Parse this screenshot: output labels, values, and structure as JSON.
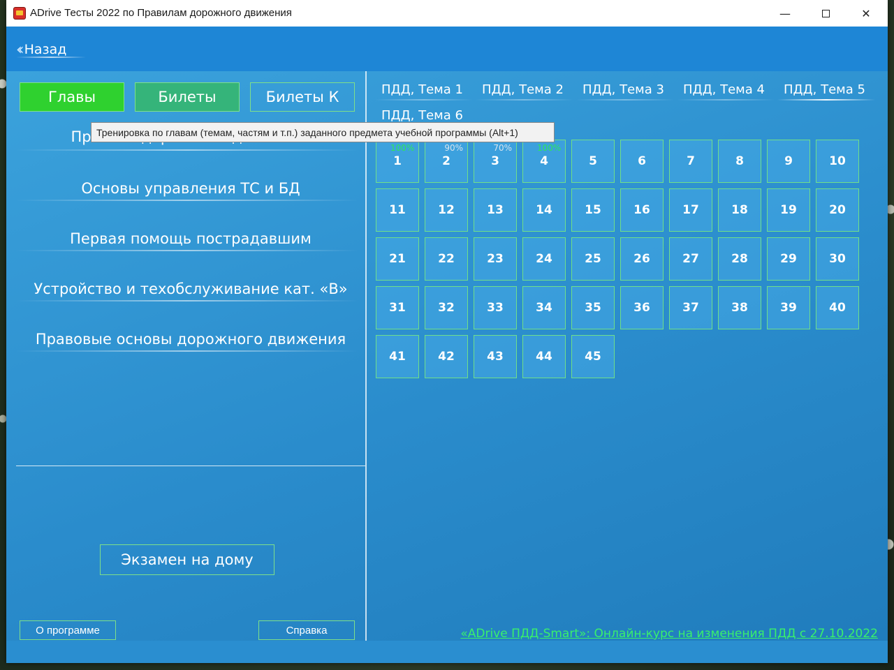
{
  "window": {
    "title": "ADrive Тесты 2022 по Правилам дорожного движения",
    "minimize": "—",
    "close": "✕"
  },
  "header": {
    "back_label": "Назад",
    "back_icon": "double-chevron-left-icon"
  },
  "tabs": [
    {
      "label": "Главы",
      "active": true
    },
    {
      "label": "Билеты",
      "active": false
    },
    {
      "label": "Билеты К",
      "active": false
    }
  ],
  "tooltip": "Тренировка по главам (темам, частям и т.п.) заданного предмета учебной программы (Alt+1)",
  "chapters": [
    "Правила дорожного движения",
    "Основы управления ТС и БД",
    "Первая помощь пострадавшим",
    "Устройство и техобслуживание кат. «В»",
    "Правовые основы дорожного движения"
  ],
  "exam_button": "Экзамен на дому",
  "about_button": "О программе",
  "help_button": "Справка",
  "topics": [
    {
      "label": "ПДД, Тема 1",
      "active": false
    },
    {
      "label": "ПДД, Тема 2",
      "active": false
    },
    {
      "label": "ПДД, Тема 3",
      "active": false
    },
    {
      "label": "ПДД, Тема 4",
      "active": false
    },
    {
      "label": "ПДД, Тема 5",
      "active": true
    },
    {
      "label": "ПДД, Тема 6",
      "active": false
    }
  ],
  "tiles": [
    {
      "n": "1",
      "pct": "100%"
    },
    {
      "n": "2",
      "pct": "90%"
    },
    {
      "n": "3",
      "pct": "70%"
    },
    {
      "n": "4",
      "pct": "100%"
    },
    {
      "n": "5",
      "pct": ""
    },
    {
      "n": "6",
      "pct": ""
    },
    {
      "n": "7",
      "pct": ""
    },
    {
      "n": "8",
      "pct": ""
    },
    {
      "n": "9",
      "pct": ""
    },
    {
      "n": "10",
      "pct": ""
    },
    {
      "n": "11",
      "pct": ""
    },
    {
      "n": "12",
      "pct": ""
    },
    {
      "n": "13",
      "pct": ""
    },
    {
      "n": "14",
      "pct": ""
    },
    {
      "n": "15",
      "pct": ""
    },
    {
      "n": "16",
      "pct": ""
    },
    {
      "n": "17",
      "pct": ""
    },
    {
      "n": "18",
      "pct": ""
    },
    {
      "n": "19",
      "pct": ""
    },
    {
      "n": "20",
      "pct": ""
    },
    {
      "n": "21",
      "pct": ""
    },
    {
      "n": "22",
      "pct": ""
    },
    {
      "n": "23",
      "pct": ""
    },
    {
      "n": "24",
      "pct": ""
    },
    {
      "n": "25",
      "pct": ""
    },
    {
      "n": "26",
      "pct": ""
    },
    {
      "n": "27",
      "pct": ""
    },
    {
      "n": "28",
      "pct": ""
    },
    {
      "n": "29",
      "pct": ""
    },
    {
      "n": "30",
      "pct": ""
    },
    {
      "n": "31",
      "pct": ""
    },
    {
      "n": "32",
      "pct": ""
    },
    {
      "n": "33",
      "pct": ""
    },
    {
      "n": "34",
      "pct": ""
    },
    {
      "n": "35",
      "pct": ""
    },
    {
      "n": "36",
      "pct": ""
    },
    {
      "n": "37",
      "pct": ""
    },
    {
      "n": "38",
      "pct": ""
    },
    {
      "n": "39",
      "pct": ""
    },
    {
      "n": "40",
      "pct": ""
    },
    {
      "n": "41",
      "pct": ""
    },
    {
      "n": "42",
      "pct": ""
    },
    {
      "n": "43",
      "pct": ""
    },
    {
      "n": "44",
      "pct": ""
    },
    {
      "n": "45",
      "pct": ""
    }
  ],
  "promo_link": "«ADrive ПДД-Smart»: Онлайн-курс на изменения ПДД с 27.10.2022",
  "colors": {
    "accent_green": "#2fd12f",
    "panel_blue": "#2a8ed0",
    "link_green": "#39f06c"
  }
}
